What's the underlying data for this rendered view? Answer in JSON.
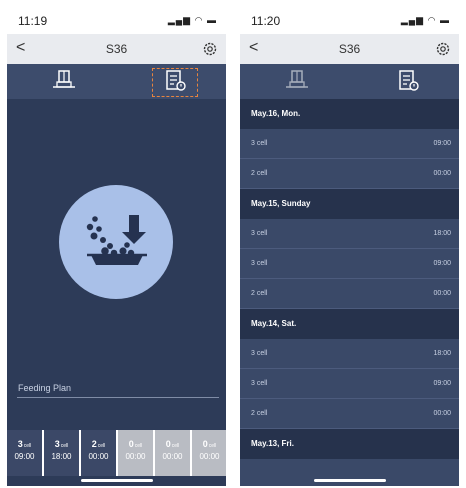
{
  "left_screen": {
    "status": {
      "time": "11:19",
      "signal": "all",
      "wifi": "wifi",
      "battery": "battery"
    },
    "nav": {
      "back": "<",
      "title": "S36",
      "settings_icon": "gear-icon"
    },
    "tabs": [
      {
        "icon": "feeder-icon"
      },
      {
        "icon": "record-list-icon",
        "selected": true
      }
    ],
    "hero_icon": "feeding-icon",
    "plan_label": "Feeding Plan",
    "plans": [
      {
        "count": "3",
        "unit": "cell",
        "time": "09:00",
        "active": true
      },
      {
        "count": "3",
        "unit": "cell",
        "time": "18:00",
        "active": true
      },
      {
        "count": "2",
        "unit": "cell",
        "time": "00:00",
        "active": true
      },
      {
        "count": "0",
        "unit": "cell",
        "time": "00:00",
        "active": false
      },
      {
        "count": "0",
        "unit": "cell",
        "time": "00:00",
        "active": false
      },
      {
        "count": "0",
        "unit": "cell",
        "time": "00:00",
        "active": false
      }
    ]
  },
  "right_screen": {
    "status": {
      "time": "11:20"
    },
    "nav": {
      "back": "<",
      "title": "S36",
      "settings_icon": "gear-icon"
    },
    "tabs": [
      {
        "icon": "feeder-icon"
      },
      {
        "icon": "record-list-icon",
        "selected": true
      }
    ],
    "records": [
      {
        "date": "May.16, Mon.",
        "entries": [
          {
            "amount": "3 cell",
            "time": "09:00"
          },
          {
            "amount": "2 cell",
            "time": "00:00"
          }
        ]
      },
      {
        "date": "May.15, Sunday",
        "entries": [
          {
            "amount": "3 cell",
            "time": "18:00"
          },
          {
            "amount": "3 cell",
            "time": "09:00"
          },
          {
            "amount": "2 cell",
            "time": "00:00"
          }
        ]
      },
      {
        "date": "May.14, Sat.",
        "entries": [
          {
            "amount": "3 cell",
            "time": "18:00"
          },
          {
            "amount": "3 cell",
            "time": "09:00"
          },
          {
            "amount": "2 cell",
            "time": "00:00"
          }
        ]
      },
      {
        "date": "May.13, Fri.",
        "entries": [
          {
            "amount": "",
            "time": ""
          }
        ]
      }
    ]
  },
  "colors": {
    "background": "#2d3b58",
    "tabbar": "#3d4c6c",
    "accent": "#e8843e",
    "hero": "#a9c0e8",
    "cell_off": "#b9bcc3"
  }
}
